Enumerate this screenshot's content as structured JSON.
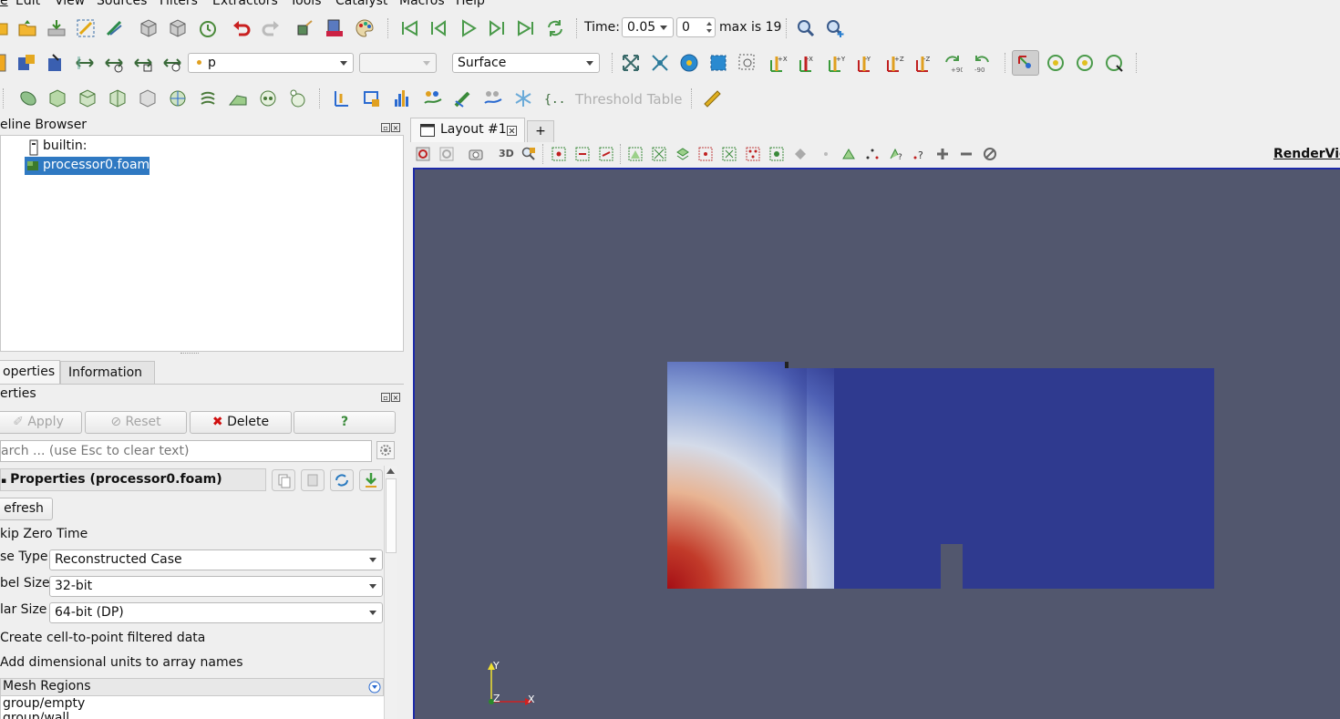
{
  "menu": {
    "items": [
      "Edit",
      "View",
      "Sources",
      "Filters",
      "Extractors",
      "Tools",
      "Catalyst",
      "Macros",
      "Help"
    ],
    "first_char": "e"
  },
  "time_toolbar": {
    "time_label": "Time:",
    "time_value": "0.05",
    "step_value": "0",
    "max_label": "max is 19"
  },
  "color_toolbar": {
    "array_value": "p",
    "component_value": "",
    "representation_value": "Surface"
  },
  "common_toolbar": {
    "threshold_label": "Threshold Table"
  },
  "pipeline_browser": {
    "title": "eline Browser",
    "root_label": "builtin:",
    "item_label": "processor0.foam"
  },
  "properties_tabs": {
    "tab1": "operties",
    "tab2": "Information"
  },
  "properties_panel": {
    "title": "erties",
    "apply_label": "Apply",
    "reset_label": "Reset",
    "delete_label": "Delete",
    "help_label": "?",
    "search_placeholder": "arch ... (use Esc to clear text)",
    "section_title": "Properties (processor0.foam)",
    "refresh_label": "efresh",
    "skip_zero_time_label": "kip Zero Time",
    "case_type_label": "se Type",
    "case_type_value": "Reconstructed Case",
    "label_size_label": "bel Size",
    "label_size_value": "32-bit",
    "scalar_size_label": "lar Size",
    "scalar_size_value": "64-bit (DP)",
    "cell_to_point_label": "Create cell-to-point filtered data",
    "dimensional_units_label": "Add dimensional units to array names",
    "mesh_regions_label": "Mesh Regions",
    "mesh_regions_items": [
      "group/empty",
      "group/wall"
    ]
  },
  "layout": {
    "tab_label": "Layout #1",
    "add_tab_label": "+",
    "render_view_label": "RenderVie",
    "threed_label": "3D"
  },
  "axes": {
    "y": "Y",
    "z": "Z",
    "x": "X"
  },
  "colors": {
    "render_bg": "#52576e",
    "field_low": "#2f3a8f",
    "field_high": "#a50f15",
    "selection": "#2f79c2"
  }
}
